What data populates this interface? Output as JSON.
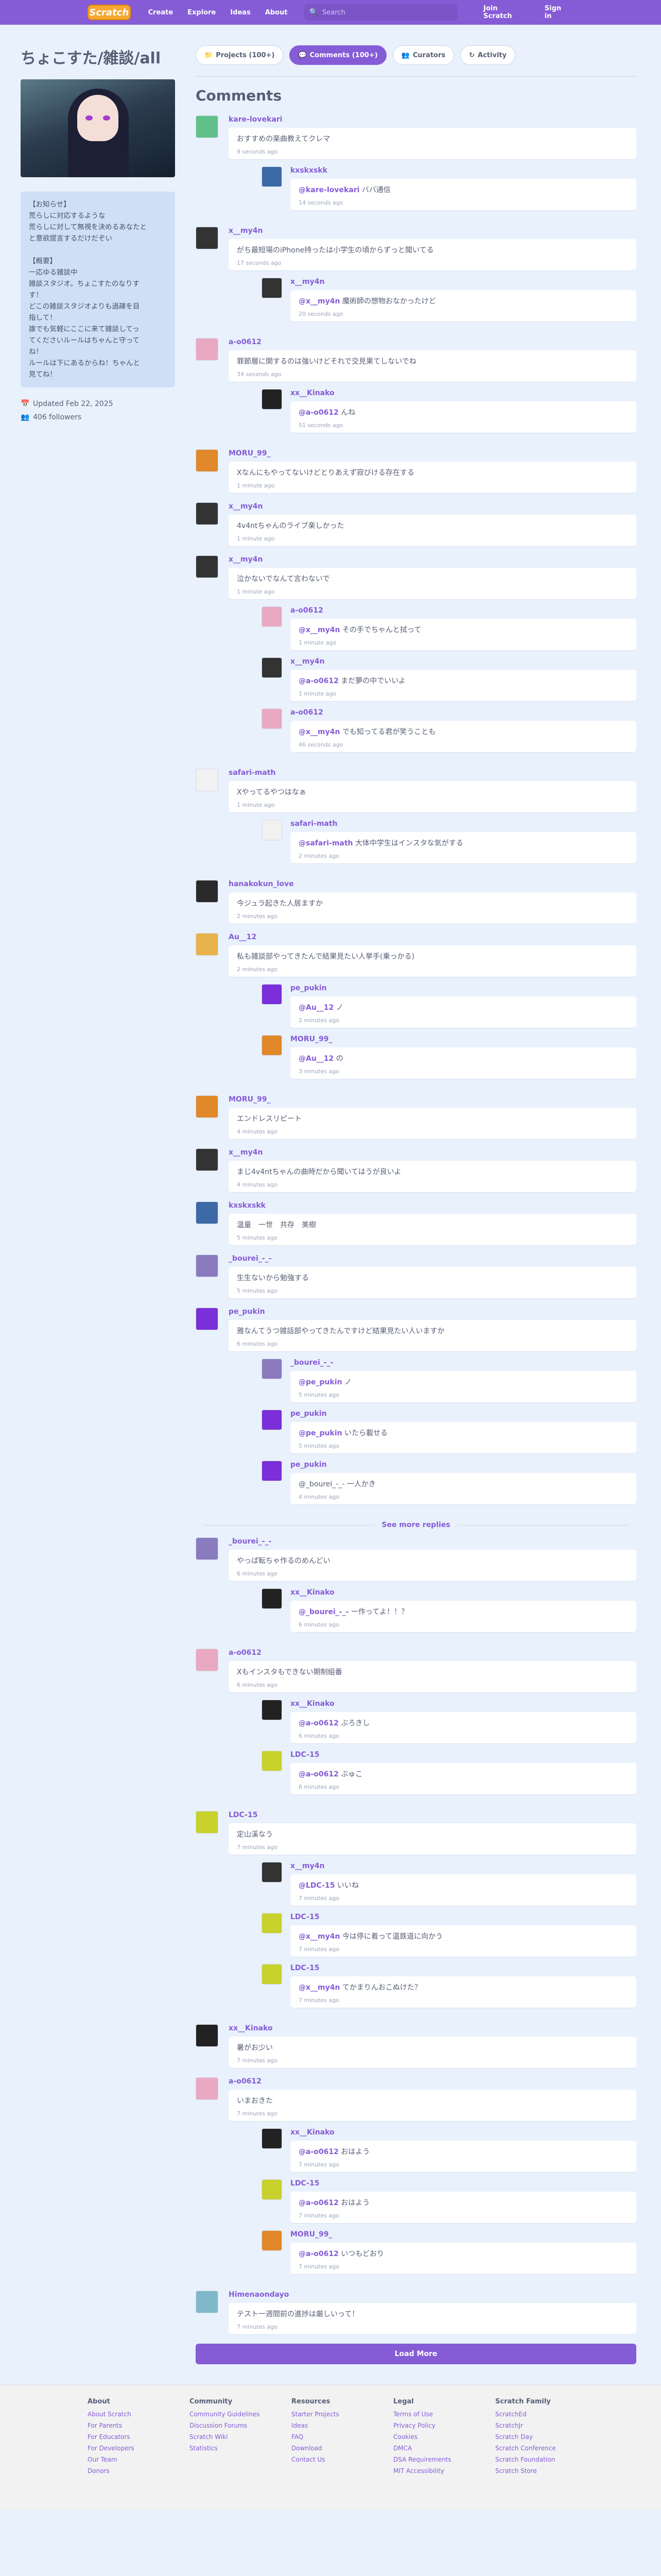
{
  "nav": {
    "logo": "Scratch",
    "links": [
      "Create",
      "Explore",
      "Ideas",
      "About"
    ],
    "search_placeholder": "Search",
    "join": "Join Scratch",
    "signin": "Sign in"
  },
  "studio": {
    "title": "ちょこすた/雑談/all",
    "description": "【お知らせ】\n荒らしに対応するような\n荒らしに対して無視を決めるあなたと\nと意欲提言するだけだぞい\n\n【概要】\n一応ゆる雑談中\n雑談スタジオ。ちょこすたのなりす\nす！\nどこの雑談スタジオよりも過疎を目\n指して！\n誰でも気軽にここに来て雑談してっ\nてくださいルールはちゃんと守って\nね！\nルールは下にあるからね！ちゃんと\n見てね！",
    "updated": "Updated Feb 22, 2025",
    "followers": "406 followers"
  },
  "tabs": [
    {
      "label": "Projects (100+)",
      "icon": "folder-icon",
      "active": false
    },
    {
      "label": "Comments (100+)",
      "icon": "speech-icon",
      "active": true
    },
    {
      "label": "Curators",
      "icon": "people-icon",
      "active": false
    },
    {
      "label": "Activity",
      "icon": "refresh-icon",
      "active": false
    }
  ],
  "comments_title": "Comments",
  "comments": [
    {
      "user": "kare-lovekari",
      "color": "#62c08a",
      "text": "おすすめの楽曲教えてクレマ",
      "time": "9 seconds ago",
      "replies": [
        {
          "user": "kxskxskk",
          "color": "#3d6aa6",
          "mention": "@kare-lovekari",
          "text": " ババ通信",
          "time": "14 seconds ago"
        }
      ]
    },
    {
      "user": "x__my4n",
      "color": "#333333",
      "text": "がち最短場のiPhone持ったは小学生の頃からずっと聞いてる",
      "time": "17 seconds ago",
      "replies": [
        {
          "user": "x__my4n",
          "color": "#333333",
          "mention": "@x__my4n",
          "text": " 魔術師の想物おなかったけど",
          "time": "20 seconds ago"
        }
      ]
    },
    {
      "user": "a-o0612",
      "color": "#e9a9c2",
      "text": "罪節層に関するのは強いけどそれで交見果てしないでね",
      "time": "34 seconds ago",
      "replies": [
        {
          "user": "xx__Kinako",
          "color": "#222222",
          "mention": "@a-o0612",
          "text": " んね",
          "time": "51 seconds ago"
        }
      ]
    },
    {
      "user": "MORU_99_",
      "color": "#e0882a",
      "text": "Xなんにもやってないけどとりあえず寂びける存在する",
      "time": "1 minute ago",
      "replies": []
    },
    {
      "user": "x__my4n",
      "color": "#333333",
      "text": "4v4ntちゃんのライブ楽しかった",
      "time": "1 minute ago",
      "replies": []
    },
    {
      "user": "x__my4n",
      "color": "#333333",
      "text": "泣かないでなんて言わないで",
      "time": "1 minute ago",
      "replies": [
        {
          "user": "a-o0612",
          "color": "#e9a9c2",
          "mention": "@x__my4n",
          "text": " その手でちゃんと拭って",
          "time": "1 minute ago"
        },
        {
          "user": "x__my4n",
          "color": "#333333",
          "mention": "@a-o0612",
          "text": " まだ夢の中でいいよ",
          "time": "1 minute ago"
        },
        {
          "user": "a-o0612",
          "color": "#e9a9c2",
          "mention": "@x__my4n",
          "text": " でも知ってる君が笑うことも",
          "time": "46 seconds ago"
        }
      ]
    },
    {
      "user": "safari-math",
      "color": "#f1f1f1",
      "text": "Xやってるやつはなぁ",
      "time": "1 minute ago",
      "replies": [
        {
          "user": "safari-math",
          "color": "#f1f1f1",
          "mention": "@safari-math",
          "text": " 大体中学生はインスタな気がする",
          "time": "2 minutes ago"
        }
      ]
    },
    {
      "user": "hanakokun_love",
      "color": "#2a2a2a",
      "text": "今ジュラ起きた人居ますか",
      "time": "2 minutes ago",
      "replies": []
    },
    {
      "user": "Au__12",
      "color": "#e8b34a",
      "text": "私も雑談部やってきたんで結果見たい人挙手(乗っかる)",
      "time": "2 minutes ago",
      "replies": [
        {
          "user": "pe_pukin",
          "color": "#7a2fd8",
          "mention": "@Au__12",
          "text": " ノ",
          "time": "2 minutes ago"
        },
        {
          "user": "MORU_99_",
          "color": "#e0882a",
          "mention": "@Au__12",
          "text": " の",
          "time": "3 minutes ago"
        }
      ]
    },
    {
      "user": "MORU_99_",
      "color": "#e0882a",
      "text": "エンドレスリピート",
      "time": "4 minutes ago",
      "replies": []
    },
    {
      "user": "x__my4n",
      "color": "#333333",
      "text": "まじ4v4ntちゃんの曲時だから聞いてはうが良いよ",
      "time": "4 minutes ago",
      "replies": []
    },
    {
      "user": "kxskxskk",
      "color": "#3d6aa6",
      "text": "温量　一世　共存　美樹",
      "time": "5 minutes ago",
      "replies": []
    },
    {
      "user": "_bourei_-_-",
      "color": "#8a7bbf",
      "text": "生生ないから勉強する",
      "time": "5 minutes ago",
      "replies": []
    },
    {
      "user": "pe_pukin",
      "color": "#7a2fd8",
      "text": "雅なんてうつ雑話部やってきたんですけど結果見たい人いますか",
      "time": "6 minutes ago",
      "replies": [
        {
          "user": "_bourei_-_-",
          "color": "#8a7bbf",
          "mention": "@pe_pukin",
          "text": " ノ",
          "time": "5 minutes ago"
        },
        {
          "user": "pe_pukin",
          "color": "#7a2fd8",
          "mention": "@pe_pukin",
          "text": " いたら載せる",
          "time": "5 minutes ago"
        },
        {
          "user": "pe_pukin",
          "color": "#7a2fd8",
          "mention": "",
          "text": "@_bourei_-_- 一人かき",
          "time": "4 minutes ago"
        }
      ]
    }
  ],
  "see_more": "See more replies",
  "comments2": [
    {
      "user": "_bourei_-_-",
      "color": "#8a7bbf",
      "text": "やっぱ転ちゃ作るのめんどい",
      "time": "6 minutes ago",
      "replies": [
        {
          "user": "xx__Kinako",
          "color": "#222222",
          "mention": "@_bourei_-_-",
          "text": " ー作ってよ！！？",
          "time": "6 minutes ago"
        }
      ]
    },
    {
      "user": "a-o0612",
      "color": "#e9a9c2",
      "text": "Xもインスタもできない期制組番",
      "time": "6 minutes ago",
      "replies": [
        {
          "user": "xx__Kinako",
          "color": "#222222",
          "mention": "@a-o0612",
          "text": " ぶろきし",
          "time": "6 minutes ago"
        },
        {
          "user": "LDC-15",
          "color": "#c9d12c",
          "mention": "@a-o0612",
          "text": " ぶゅこ",
          "time": "6 minutes ago"
        }
      ]
    },
    {
      "user": "LDC-15",
      "color": "#c9d12c",
      "text": "定山溪なう",
      "time": "7 minutes ago",
      "replies": [
        {
          "user": "x__my4n",
          "color": "#333333",
          "mention": "@LDC-15",
          "text": " いいね",
          "time": "7 minutes ago"
        },
        {
          "user": "LDC-15",
          "color": "#c9d12c",
          "mention": "@x__my4n",
          "text": " 今は停に着って温鉄道に向かう",
          "time": "7 minutes ago"
        },
        {
          "user": "LDC-15",
          "color": "#c9d12c",
          "mention": "@x__my4n",
          "text": " てかまりんおこぬけた？",
          "time": "7 minutes ago"
        }
      ]
    },
    {
      "user": "xx__Kinako",
      "color": "#222222",
      "text": "暑がお少い",
      "time": "7 minutes ago",
      "replies": []
    },
    {
      "user": "a-o0612",
      "color": "#e9a9c2",
      "text": "いまおきた",
      "time": "7 minutes ago",
      "replies": [
        {
          "user": "xx__Kinako",
          "color": "#222222",
          "mention": "@a-o0612",
          "text": " おはよう",
          "time": "7 minutes ago"
        },
        {
          "user": "LDC-15",
          "color": "#c9d12c",
          "mention": "@a-o0612",
          "text": " おはよう",
          "time": "7 minutes ago"
        },
        {
          "user": "MORU_99_",
          "color": "#e0882a",
          "mention": "@a-o0612",
          "text": " いつもどおり",
          "time": "7 minutes ago"
        }
      ]
    },
    {
      "user": "Himenaondayo",
      "color": "#7fb9c9",
      "text": "テスト一週間前の進捗は厳しいって！",
      "time": "7 minutes ago",
      "replies": []
    }
  ],
  "load_more": "Load More",
  "footer": [
    {
      "title": "About",
      "links": [
        "About Scratch",
        "For Parents",
        "For Educators",
        "For Developers",
        "Our Team",
        "Donors"
      ]
    },
    {
      "title": "Community",
      "links": [
        "Community Guidelines",
        "Discussion Forums",
        "Scratch Wiki",
        "Statistics"
      ]
    },
    {
      "title": "Resources",
      "links": [
        "Starter Projects",
        "Ideas",
        "FAQ",
        "Download",
        "Contact Us"
      ]
    },
    {
      "title": "Legal",
      "links": [
        "Terms of Use",
        "Privacy Policy",
        "Cookies",
        "DMCA",
        "DSA Requirements",
        "MIT Accessibility"
      ]
    },
    {
      "title": "Scratch Family",
      "links": [
        "ScratchEd",
        "ScratchJr",
        "Scratch Day",
        "Scratch Conference",
        "Scratch Foundation",
        "Scratch Store"
      ]
    }
  ]
}
